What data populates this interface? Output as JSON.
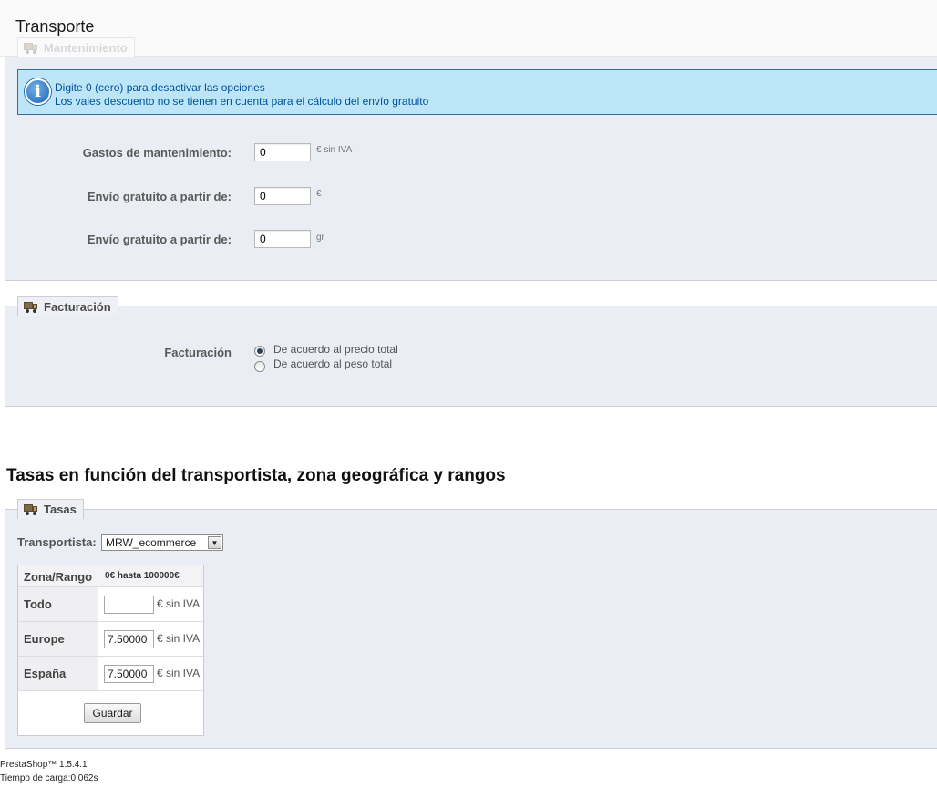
{
  "page": {
    "title": "Transporte"
  },
  "maintenance": {
    "legend": "Mantenimiento",
    "info_lines": [
      "Digite 0 (cero) para desactivar las opciones",
      "Los vales descuento no se tienen en cuenta para el cálculo del envío gratuito"
    ],
    "fields": [
      {
        "label": "Gastos de mantenimiento:",
        "value": "0",
        "suffix": "€ sin IVA"
      },
      {
        "label": "Envío gratuito a partir de:",
        "value": "0",
        "suffix": "€"
      },
      {
        "label": "Envío gratuito a partir de:",
        "value": "0",
        "suffix": "gr"
      }
    ]
  },
  "billing": {
    "legend": "Facturación",
    "label": "Facturación",
    "options": [
      {
        "label": "De acuerdo al precio total",
        "checked": true
      },
      {
        "label": "De acuerdo al peso total",
        "checked": false
      }
    ]
  },
  "rates": {
    "heading": "Tasas en función del transportista, zona geográfica y rangos",
    "legend": "Tasas",
    "carrier_label": "Transportista:",
    "carrier_selected": "MRW_ecommerce",
    "table": {
      "zone_header": "Zona/Rango",
      "range_header": "0€ hasta 100000€",
      "unit": "€ sin IVA",
      "rows": [
        {
          "zone": "Todo",
          "value": ""
        },
        {
          "zone": "Europe",
          "value": "7.50000"
        },
        {
          "zone": "España",
          "value": "7.50000"
        }
      ]
    },
    "save_label": "Guardar"
  },
  "footer": {
    "version": "PrestaShop™ 1.5.4.1",
    "load_time": "Tiempo de carga:0.062s"
  }
}
